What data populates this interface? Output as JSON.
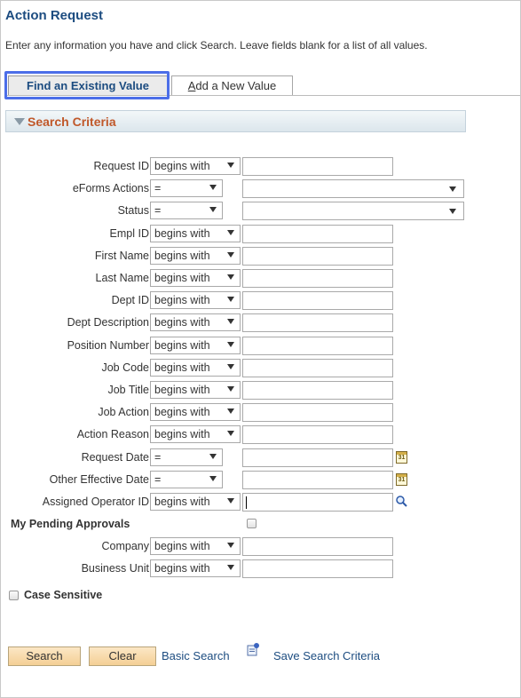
{
  "page": {
    "title": "Action Request",
    "instructions": "Enter any information you have and click Search. Leave fields blank for a list of all values."
  },
  "tabs": {
    "find_existing": "Find an Existing Value",
    "add_new_prefix": "A",
    "add_new_rest": "dd a New Value"
  },
  "section": {
    "title": "Search Criteria"
  },
  "criteria": [
    {
      "label": "Request ID",
      "operator": "begins with",
      "type": "text"
    },
    {
      "label": "eForms Actions",
      "operator": "=",
      "type": "select"
    },
    {
      "label": "Status",
      "operator": "=",
      "type": "select"
    },
    {
      "label": "Empl ID",
      "operator": "begins with",
      "type": "text"
    },
    {
      "label": "First Name",
      "operator": "begins with",
      "type": "text"
    },
    {
      "label": "Last Name",
      "operator": "begins with",
      "type": "text"
    },
    {
      "label": "Dept ID",
      "operator": "begins with",
      "type": "text"
    },
    {
      "label": "Dept Description",
      "operator": "begins with",
      "type": "text"
    },
    {
      "label": "Position Number",
      "operator": "begins with",
      "type": "text"
    },
    {
      "label": "Job Code",
      "operator": "begins with",
      "type": "text"
    },
    {
      "label": "Job Title",
      "operator": "begins with",
      "type": "text"
    },
    {
      "label": "Job Action",
      "operator": "begins with",
      "type": "text"
    },
    {
      "label": "Action Reason",
      "operator": "begins with",
      "type": "text"
    },
    {
      "label": "Request Date",
      "operator": "=",
      "type": "date"
    },
    {
      "label": "Other Effective Date",
      "operator": "=",
      "type": "date"
    },
    {
      "label": "Assigned Operator ID",
      "operator": "begins with",
      "type": "lookup"
    }
  ],
  "pending": {
    "label": "My Pending Approvals",
    "checked": false
  },
  "criteria2": [
    {
      "label": "Company",
      "operator": "begins with"
    },
    {
      "label": "Business Unit",
      "operator": "begins with"
    }
  ],
  "case_sensitive": {
    "label": "Case Sensitive",
    "checked": false
  },
  "buttons": {
    "search": "Search",
    "clear": "Clear",
    "basic_search": "Basic Search",
    "save_criteria": "Save Search Criteria"
  },
  "calendar_icon_text": "31",
  "colors": {
    "title": "#1c4c80",
    "section_title": "#c0582a",
    "button_bg": "#f4cf95",
    "focus_ring": "#4c6ee8"
  }
}
